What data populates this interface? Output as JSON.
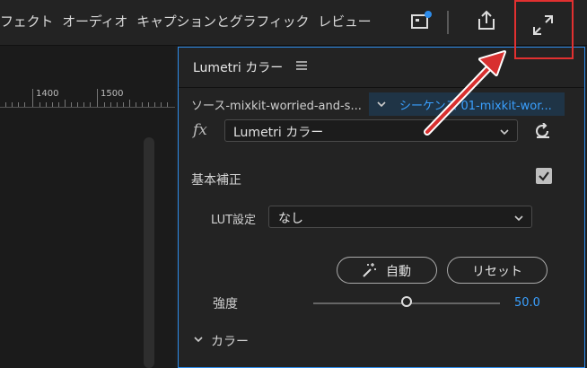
{
  "topnav": {
    "items": [
      "フェクト",
      "オーディオ",
      "キャプションとグラフィック",
      "レビュー"
    ]
  },
  "icons": {
    "quick_export": "quick-export-icon",
    "share": "share-icon",
    "fullscreen": "fullscreen-icon",
    "accent": "#2d8ceb",
    "highlight": "#e13030"
  },
  "timeline": {
    "ruler_labels": [
      "1400",
      "1500"
    ]
  },
  "lumetri": {
    "title": "Lumetri カラー",
    "source_label": "ソース-mixkit-worried-and-s...",
    "sequence_label": "シーケンス 01-mixkit-wor...",
    "fx_label": "fx",
    "effect_name": "Lumetri カラー",
    "basic": {
      "title": "基本補正",
      "lut_label": "LUT設定",
      "lut_value": "なし",
      "auto_label": "自動",
      "reset_label": "リセット",
      "intensity_label": "強度",
      "intensity_value": "50.0",
      "intensity_fraction": 0.5
    },
    "color_section": "カラー"
  }
}
